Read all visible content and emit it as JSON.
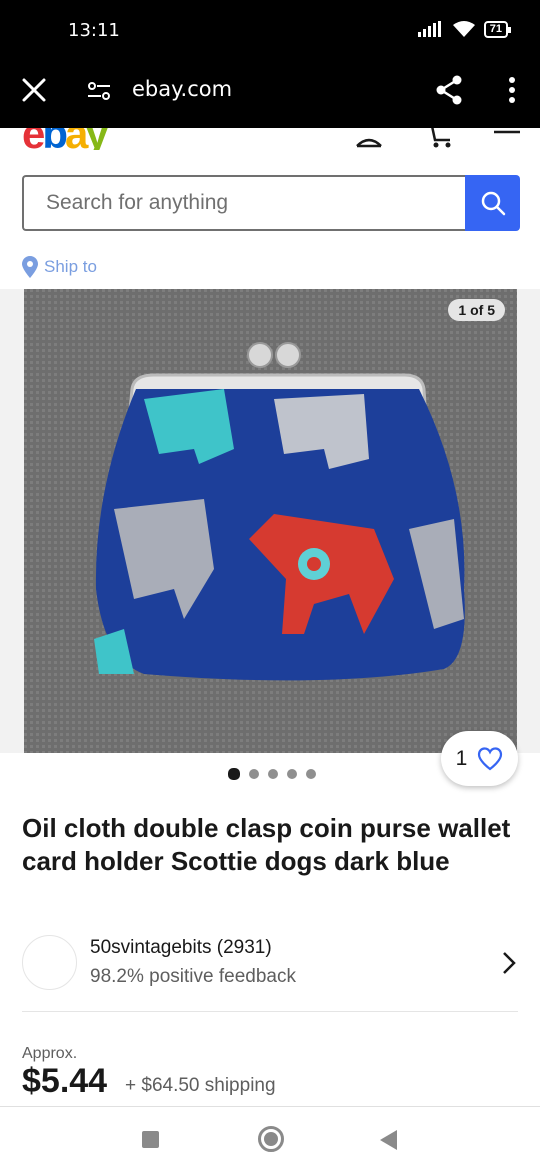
{
  "status_bar": {
    "time": "13:11",
    "battery": "71"
  },
  "browser": {
    "url": "ebay.com"
  },
  "header": {
    "logo": "ebay"
  },
  "search": {
    "placeholder": "Search for anything"
  },
  "ship_to": {
    "label": "Ship to"
  },
  "gallery": {
    "counter": "1 of 5",
    "total_images": 5,
    "active_index": 0
  },
  "watch": {
    "count": "1"
  },
  "item": {
    "title": "Oil cloth double clasp coin purse wallet card holder Scottie dogs dark blue"
  },
  "seller": {
    "name": "50svintagebits (2931)",
    "feedback": "98.2% positive feedback"
  },
  "pricing": {
    "approx_label": "Approx.",
    "price": "$5.44",
    "shipping": "+ $64.50 shipping"
  },
  "colors": {
    "accent": "#3665f3",
    "logo_e": "#e53238",
    "logo_b": "#0064d2",
    "logo_a": "#f5af02",
    "logo_y": "#86b817"
  },
  "icons": [
    "close-icon",
    "site-settings-icon",
    "share-icon",
    "more-vert-icon",
    "account-icon",
    "cart-icon",
    "menu-icon",
    "search-icon",
    "location-pin-icon",
    "heart-icon",
    "chevron-right-icon"
  ]
}
